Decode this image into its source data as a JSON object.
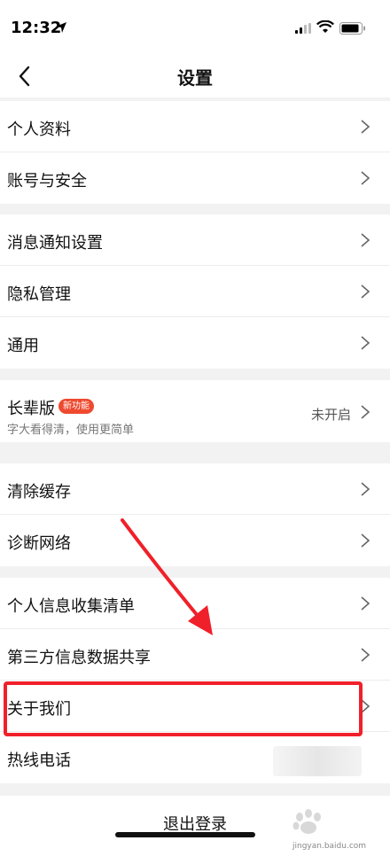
{
  "status_bar": {
    "time": "12:32"
  },
  "nav": {
    "title": "设置"
  },
  "groups": [
    {
      "items": [
        {
          "label": "个人资料"
        },
        {
          "label": "账号与安全"
        }
      ]
    },
    {
      "items": [
        {
          "label": "消息通知设置"
        },
        {
          "label": "隐私管理"
        },
        {
          "label": "通用"
        }
      ]
    },
    {
      "items": [
        {
          "label": "长辈版",
          "badge": "新功能",
          "subtitle": "字大看得清，使用更简单",
          "value": "未开启"
        }
      ]
    },
    {
      "items": [
        {
          "label": "清除缓存"
        },
        {
          "label": "诊断网络"
        }
      ]
    },
    {
      "items": [
        {
          "label": "个人信息收集清单"
        },
        {
          "label": "第三方信息数据共享"
        },
        {
          "label": "关于我们"
        },
        {
          "label": "热线电话"
        }
      ]
    }
  ],
  "footer": {
    "logout_label": "退出登录",
    "watermark": "jingyan.baidu.com"
  },
  "colors": {
    "annotation": "#f0202a",
    "badge": "#ee4a2f",
    "background": "#f2f2f2"
  }
}
